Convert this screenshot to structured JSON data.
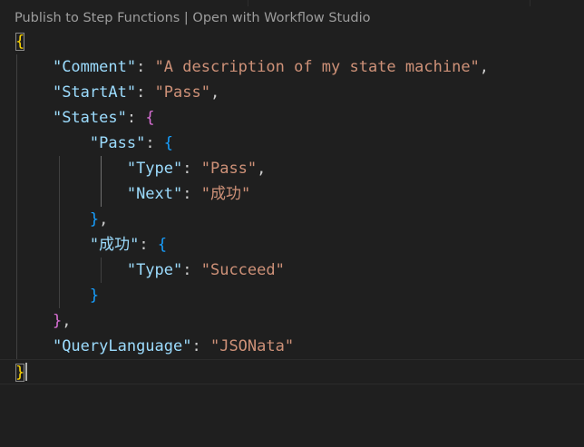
{
  "codelens": {
    "publish": "Publish to Step Functions",
    "separator": " | ",
    "open": "Open with Workflow Studio"
  },
  "code": {
    "line1_open": "{",
    "comment_key": "\"Comment\"",
    "comment_value": "\"A description of my state machine\"",
    "startat_key": "\"StartAt\"",
    "startat_value": "\"Pass\"",
    "states_key": "\"States\"",
    "states_open": "{",
    "pass_key": "\"Pass\"",
    "pass_open": "{",
    "type_key": "\"Type\"",
    "pass_type_value": "\"Pass\"",
    "next_key": "\"Next\"",
    "next_value": "\"成功\"",
    "pass_close": "}",
    "success_key": "\"成功\"",
    "success_open": "{",
    "succeed_type_value": "\"Succeed\"",
    "success_close": "}",
    "states_close": "}",
    "querylang_key": "\"QueryLanguage\"",
    "querylang_value": "\"JSONata\"",
    "line_last_close": "}",
    "colon": ": ",
    "comma": ","
  },
  "colors": {
    "background": "#1f1f1f",
    "key": "#9cdcfe",
    "string": "#ce9178",
    "bracket_level1": "#ffd700",
    "bracket_level2": "#da70d6",
    "bracket_level3": "#179fff"
  }
}
